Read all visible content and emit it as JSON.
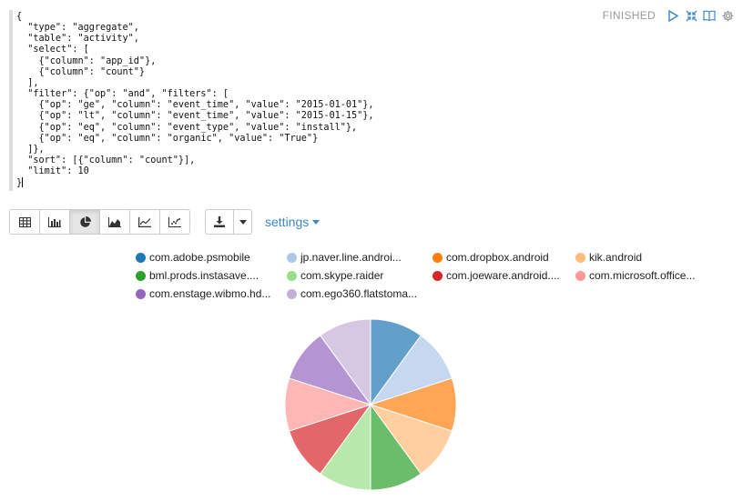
{
  "status": {
    "text": "FINISHED",
    "icons": [
      "play-icon",
      "collapse-icon",
      "book-icon",
      "gear-icon"
    ]
  },
  "editor": {
    "lines": [
      "{",
      "  \"type\": \"aggregate\",",
      "  \"table\": \"activity\",",
      "  \"select\": [",
      "    {\"column\": \"app_id\"},",
      "    {\"column\": \"count\"}",
      "  ],",
      "  \"filter\": {\"op\": \"and\", \"filters\": [",
      "    {\"op\": \"ge\", \"column\": \"event_time\", \"value\": \"2015-01-01\"},",
      "    {\"op\": \"lt\", \"column\": \"event_time\", \"value\": \"2015-01-15\"},",
      "    {\"op\": \"eq\", \"column\": \"event_type\", \"value\": \"install\"},",
      "    {\"op\": \"eq\", \"column\": \"organic\", \"value\": \"True\"}",
      "  ]},",
      "  \"sort\": [{\"column\": \"count\"}],",
      "  \"limit\": 10",
      "}"
    ]
  },
  "toolbar": {
    "view_buttons": [
      "table-icon",
      "bar-chart-icon",
      "pie-chart-icon",
      "area-chart-icon",
      "line-chart-icon",
      "scatter-chart-icon"
    ],
    "active": 2,
    "download_icon": "download-icon",
    "settings_label": "settings"
  },
  "colors": [
    "#1f77b4",
    "#aec7e8",
    "#ff7f0e",
    "#ffbb78",
    "#2ca02c",
    "#98df8a",
    "#d62728",
    "#ff9896",
    "#9467bd",
    "#c5b0d5"
  ],
  "legend": [
    "com.adobe.psmobile",
    "jp.naver.line.androi...",
    "com.dropbox.android",
    "kik.android",
    "bml.prods.instasave....",
    "com.skype.raider",
    "com.joeware.android....",
    "com.microsoft.office...",
    "com.enstage.wibmo.hd...",
    "com.ego360.flatstoma..."
  ],
  "chart_data": {
    "type": "pie",
    "labels": [
      "com.adobe.psmobile",
      "jp.naver.line.androi...",
      "com.dropbox.android",
      "kik.android",
      "bml.prods.instasave....",
      "com.skype.raider",
      "com.joeware.android....",
      "com.microsoft.office...",
      "com.enstage.wibmo.hd...",
      "com.ego360.flatstoma..."
    ],
    "values": [
      1,
      1,
      1,
      1,
      1,
      1,
      1,
      1,
      1,
      1
    ]
  }
}
